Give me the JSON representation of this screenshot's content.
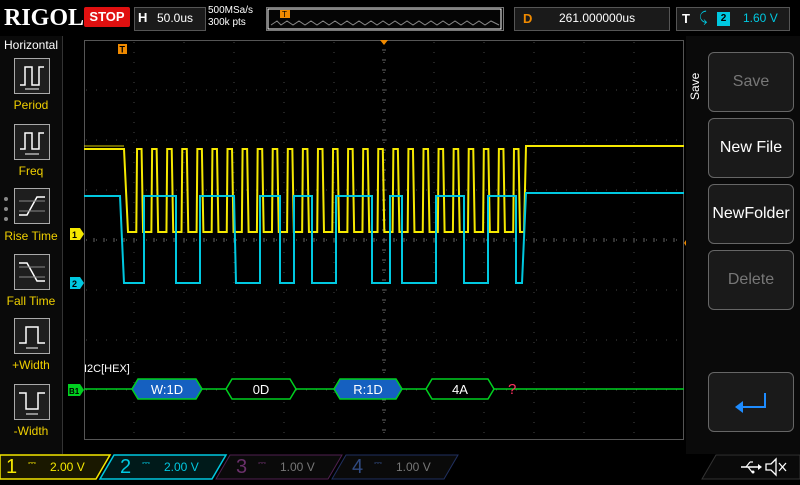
{
  "brand": "RIGOL",
  "run_state": "STOP",
  "horizontal": {
    "key": "H",
    "value": "50.0us"
  },
  "sampling": {
    "rate": "500MSa/s",
    "points": "300k pts"
  },
  "delay": {
    "key": "D",
    "value": "261.000000us"
  },
  "trigger": {
    "key": "T",
    "slope": "⤹",
    "source": "2",
    "level": "1.60 V"
  },
  "left_menu": {
    "title": "Horizontal",
    "items": [
      {
        "label": "Period"
      },
      {
        "label": "Freq"
      },
      {
        "label": "Rise Time"
      },
      {
        "label": "Fall Time"
      },
      {
        "label": "+Width"
      },
      {
        "label": "-Width"
      }
    ]
  },
  "right_menu": {
    "title": "Save",
    "items": [
      {
        "label": "Save",
        "enabled": false
      },
      {
        "label": "New File",
        "enabled": true
      },
      {
        "label": "NewFolder",
        "enabled": true
      },
      {
        "label": "Delete",
        "enabled": false
      },
      {
        "label": "↵",
        "enabled": true
      }
    ]
  },
  "decoder": {
    "label": "I2C[HEX]",
    "marker": "B1",
    "packets": [
      {
        "text": "W:1D",
        "kind": "address"
      },
      {
        "text": "0D",
        "kind": "data"
      },
      {
        "text": "R:1D",
        "kind": "address"
      },
      {
        "text": "4A",
        "kind": "data"
      },
      {
        "text": "?",
        "kind": "unknown"
      }
    ]
  },
  "markers": {
    "ch1": "1",
    "ch2": "2",
    "trig_top": "T"
  },
  "channels": [
    {
      "num": "1",
      "coupling": "⎓",
      "scale": "2.00 V",
      "color": "#f5e800",
      "active": true
    },
    {
      "num": "2",
      "coupling": "⎓",
      "scale": "2.00 V",
      "color": "#00c8e0",
      "active": true
    },
    {
      "num": "3",
      "coupling": "⎓",
      "scale": "1.00 V",
      "color": "#c000c0",
      "active": false
    },
    {
      "num": "4",
      "coupling": "⎓",
      "scale": "1.00 V",
      "color": "#2060ff",
      "active": false
    }
  ],
  "status": {
    "usb": "USB",
    "sound": "muted"
  },
  "colors": {
    "ch1": "#f5e800",
    "ch2": "#00c8e0",
    "decode": "#00d020",
    "trigger": "#f08a00",
    "stop": "#e01010"
  }
}
